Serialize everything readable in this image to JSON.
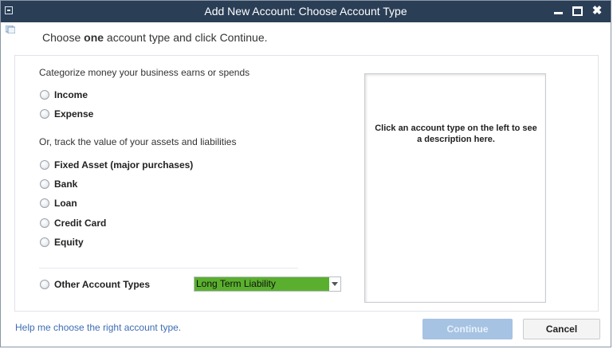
{
  "window": {
    "title": "Add New Account: Choose Account Type",
    "minimize_icon": "minimize-icon",
    "maximize_icon": "maximize-icon",
    "close_label": "✖"
  },
  "instruction": {
    "prefix": "Choose ",
    "emphasis": "one",
    "suffix": " account type and click Continue."
  },
  "categorize_section": {
    "heading": "Categorize money your business earns or spends",
    "options": [
      "Income",
      "Expense"
    ]
  },
  "track_section": {
    "heading": "Or, track the value of your assets and liabilities",
    "options": [
      "Fixed Asset (major purchases)",
      "Bank",
      "Loan",
      "Credit Card",
      "Equity"
    ]
  },
  "other": {
    "label": "Other Account Types",
    "selected": "Long Term Liability"
  },
  "description": {
    "line1": "Click an account type on the left to see",
    "line2": "a description here."
  },
  "footer": {
    "help_link": "Help me choose the right account type.",
    "continue_label": "Continue",
    "cancel_label": "Cancel"
  },
  "colors": {
    "titlebar": "#2a3e56",
    "selection": "#5ab02e",
    "link": "#3d6db4",
    "continue_disabled": "#a6c3e3"
  }
}
